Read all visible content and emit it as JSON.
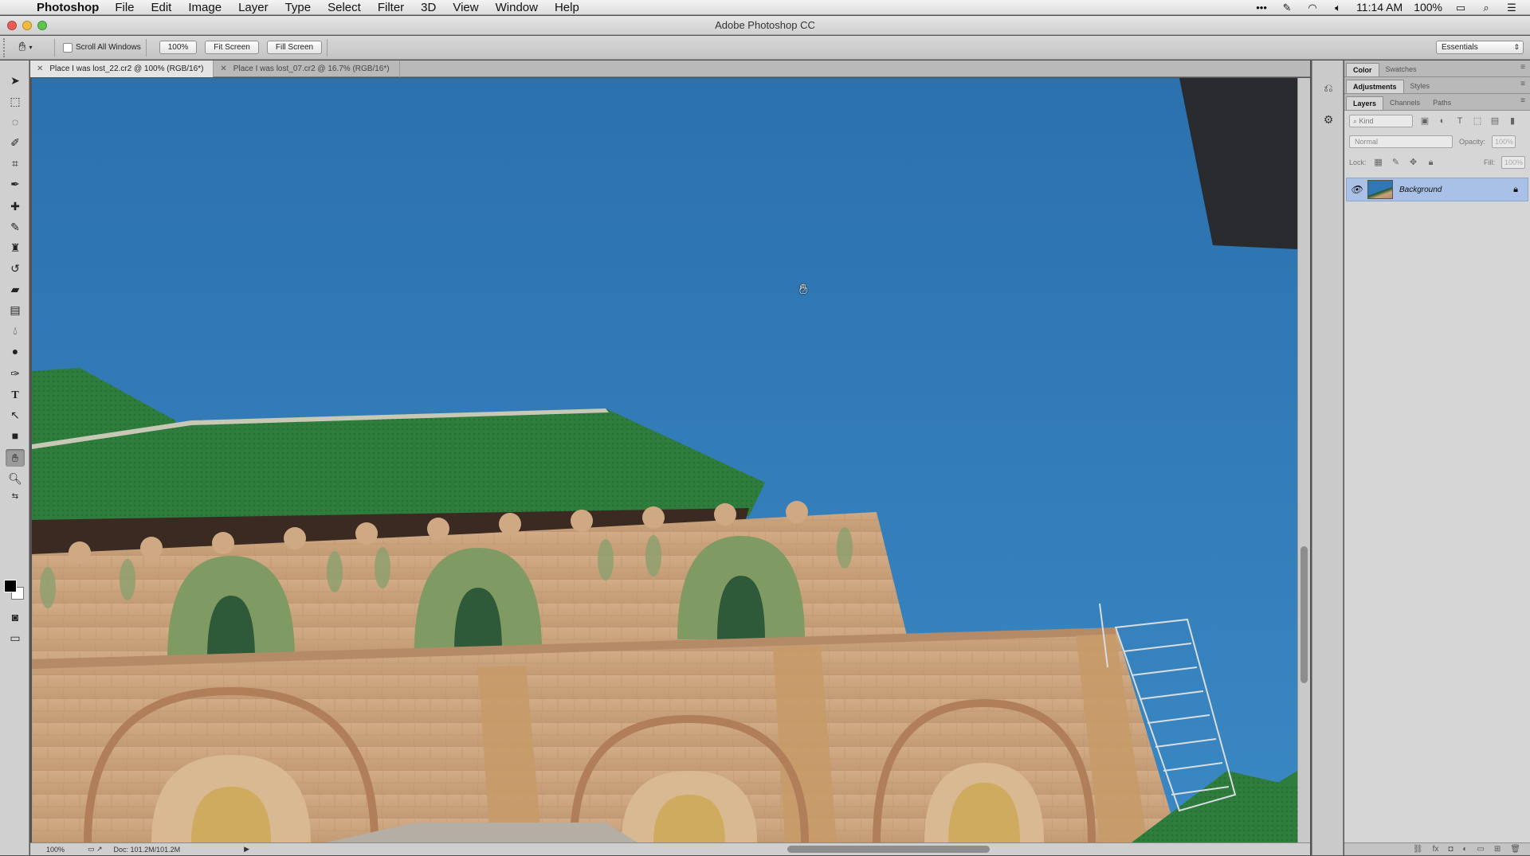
{
  "menubar": {
    "app_name": "Photoshop",
    "items": [
      "File",
      "Edit",
      "Image",
      "Layer",
      "Type",
      "Select",
      "Filter",
      "3D",
      "View",
      "Window",
      "Help"
    ],
    "time": "11:14 AM",
    "battery": "100%"
  },
  "window": {
    "title": "Adobe Photoshop CC"
  },
  "options": {
    "scroll_all_windows": "Scroll All Windows",
    "zoom_100": "100%",
    "fit_screen": "Fit Screen",
    "fill_screen": "Fill Screen",
    "workspace": "Essentials"
  },
  "doc_tabs": [
    {
      "label": "Place I was lost_22.cr2 @ 100% (RGB/16*)",
      "active": true
    },
    {
      "label": "Place I was lost_07.cr2 @ 16.7% (RGB/16*)",
      "active": false
    }
  ],
  "status": {
    "zoom": "100%",
    "doc_size": "Doc: 101.2M/101.2M"
  },
  "panels": {
    "group1": [
      "Color",
      "Swatches"
    ],
    "group2": [
      "Adjustments",
      "Styles"
    ],
    "group3": [
      "Layers",
      "Channels",
      "Paths"
    ],
    "kind_placeholder": "Kind",
    "blend_mode": "Normal",
    "opacity_label": "Opacity:",
    "opacity_value": "100%",
    "lock_label": "Lock:",
    "fill_label": "Fill:",
    "fill_value": "100%",
    "layers": [
      {
        "name": "Background",
        "visible": true,
        "locked": true
      }
    ]
  },
  "colors": {
    "sky": "#2f78b5",
    "roof": "#2e7d3c",
    "wall": "#caa27c",
    "layer_selected": "#a9c1e6"
  },
  "icons": {
    "tools": [
      "move-icon",
      "marquee-icon",
      "lasso-icon",
      "quick-select-icon",
      "crop-icon",
      "eyedropper-icon",
      "healing-brush-icon",
      "brush-icon",
      "clone-stamp-icon",
      "history-brush-icon",
      "eraser-icon",
      "gradient-icon",
      "blur-icon",
      "dodge-icon",
      "pen-icon",
      "type-icon",
      "path-select-icon",
      "shape-icon",
      "hand-icon",
      "zoom-icon"
    ]
  }
}
